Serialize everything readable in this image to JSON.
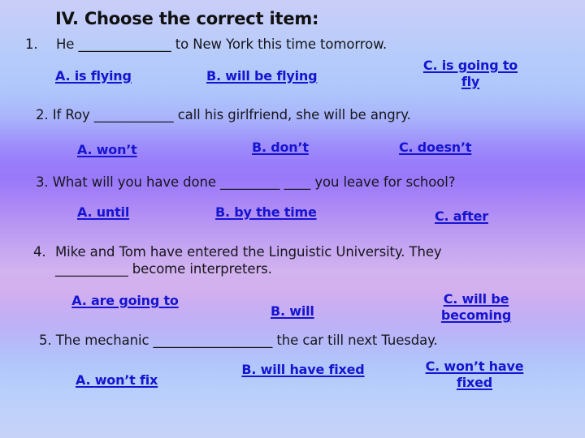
{
  "slide": {
    "title": "IV. Choose the correct item:",
    "questions": [
      {
        "number": "1.",
        "text": "He ______________ to New York this time tomorrow.",
        "options": [
          {
            "label": "A. is flying"
          },
          {
            "label": "B. will be flying"
          },
          {
            "label": "C. is going to fly"
          }
        ]
      },
      {
        "number": "2.",
        "text": "If Roy ____________ call his girlfriend, she will be angry.",
        "options": [
          {
            "label": "A. won’t"
          },
          {
            "label": "B. don’t"
          },
          {
            "label": "C. doesn’t"
          }
        ]
      },
      {
        "number": "3.",
        "text": "What will you have done _________ ____ you leave for school?",
        "options": [
          {
            "label": "A. until"
          },
          {
            "label": "B. by the time"
          },
          {
            "label": "C. after"
          }
        ]
      },
      {
        "number": "4.",
        "text": "Mike and Tom have entered the Linguistic University. They",
        "text_line2": "___________ become interpreters.",
        "options": [
          {
            "label": "A. are going to"
          },
          {
            "label": "B. will"
          },
          {
            "label": "C. will be becoming"
          }
        ]
      },
      {
        "number": "5.",
        "text": "The mechanic __________________ the car till next Tuesday.",
        "options": [
          {
            "label": "A. won’t fix"
          },
          {
            "label": "B. will have fixed"
          },
          {
            "label": "C. won’t have fixed"
          }
        ]
      }
    ]
  },
  "colors": {
    "option_text": "#1614cf",
    "question_text": "#16161c",
    "title_text": "#101010",
    "background_top": "#c9cdf7",
    "background_mid": "#9a79fa",
    "background_lower": "#d3b0ee",
    "background_bottom": "#c7d2f8"
  }
}
